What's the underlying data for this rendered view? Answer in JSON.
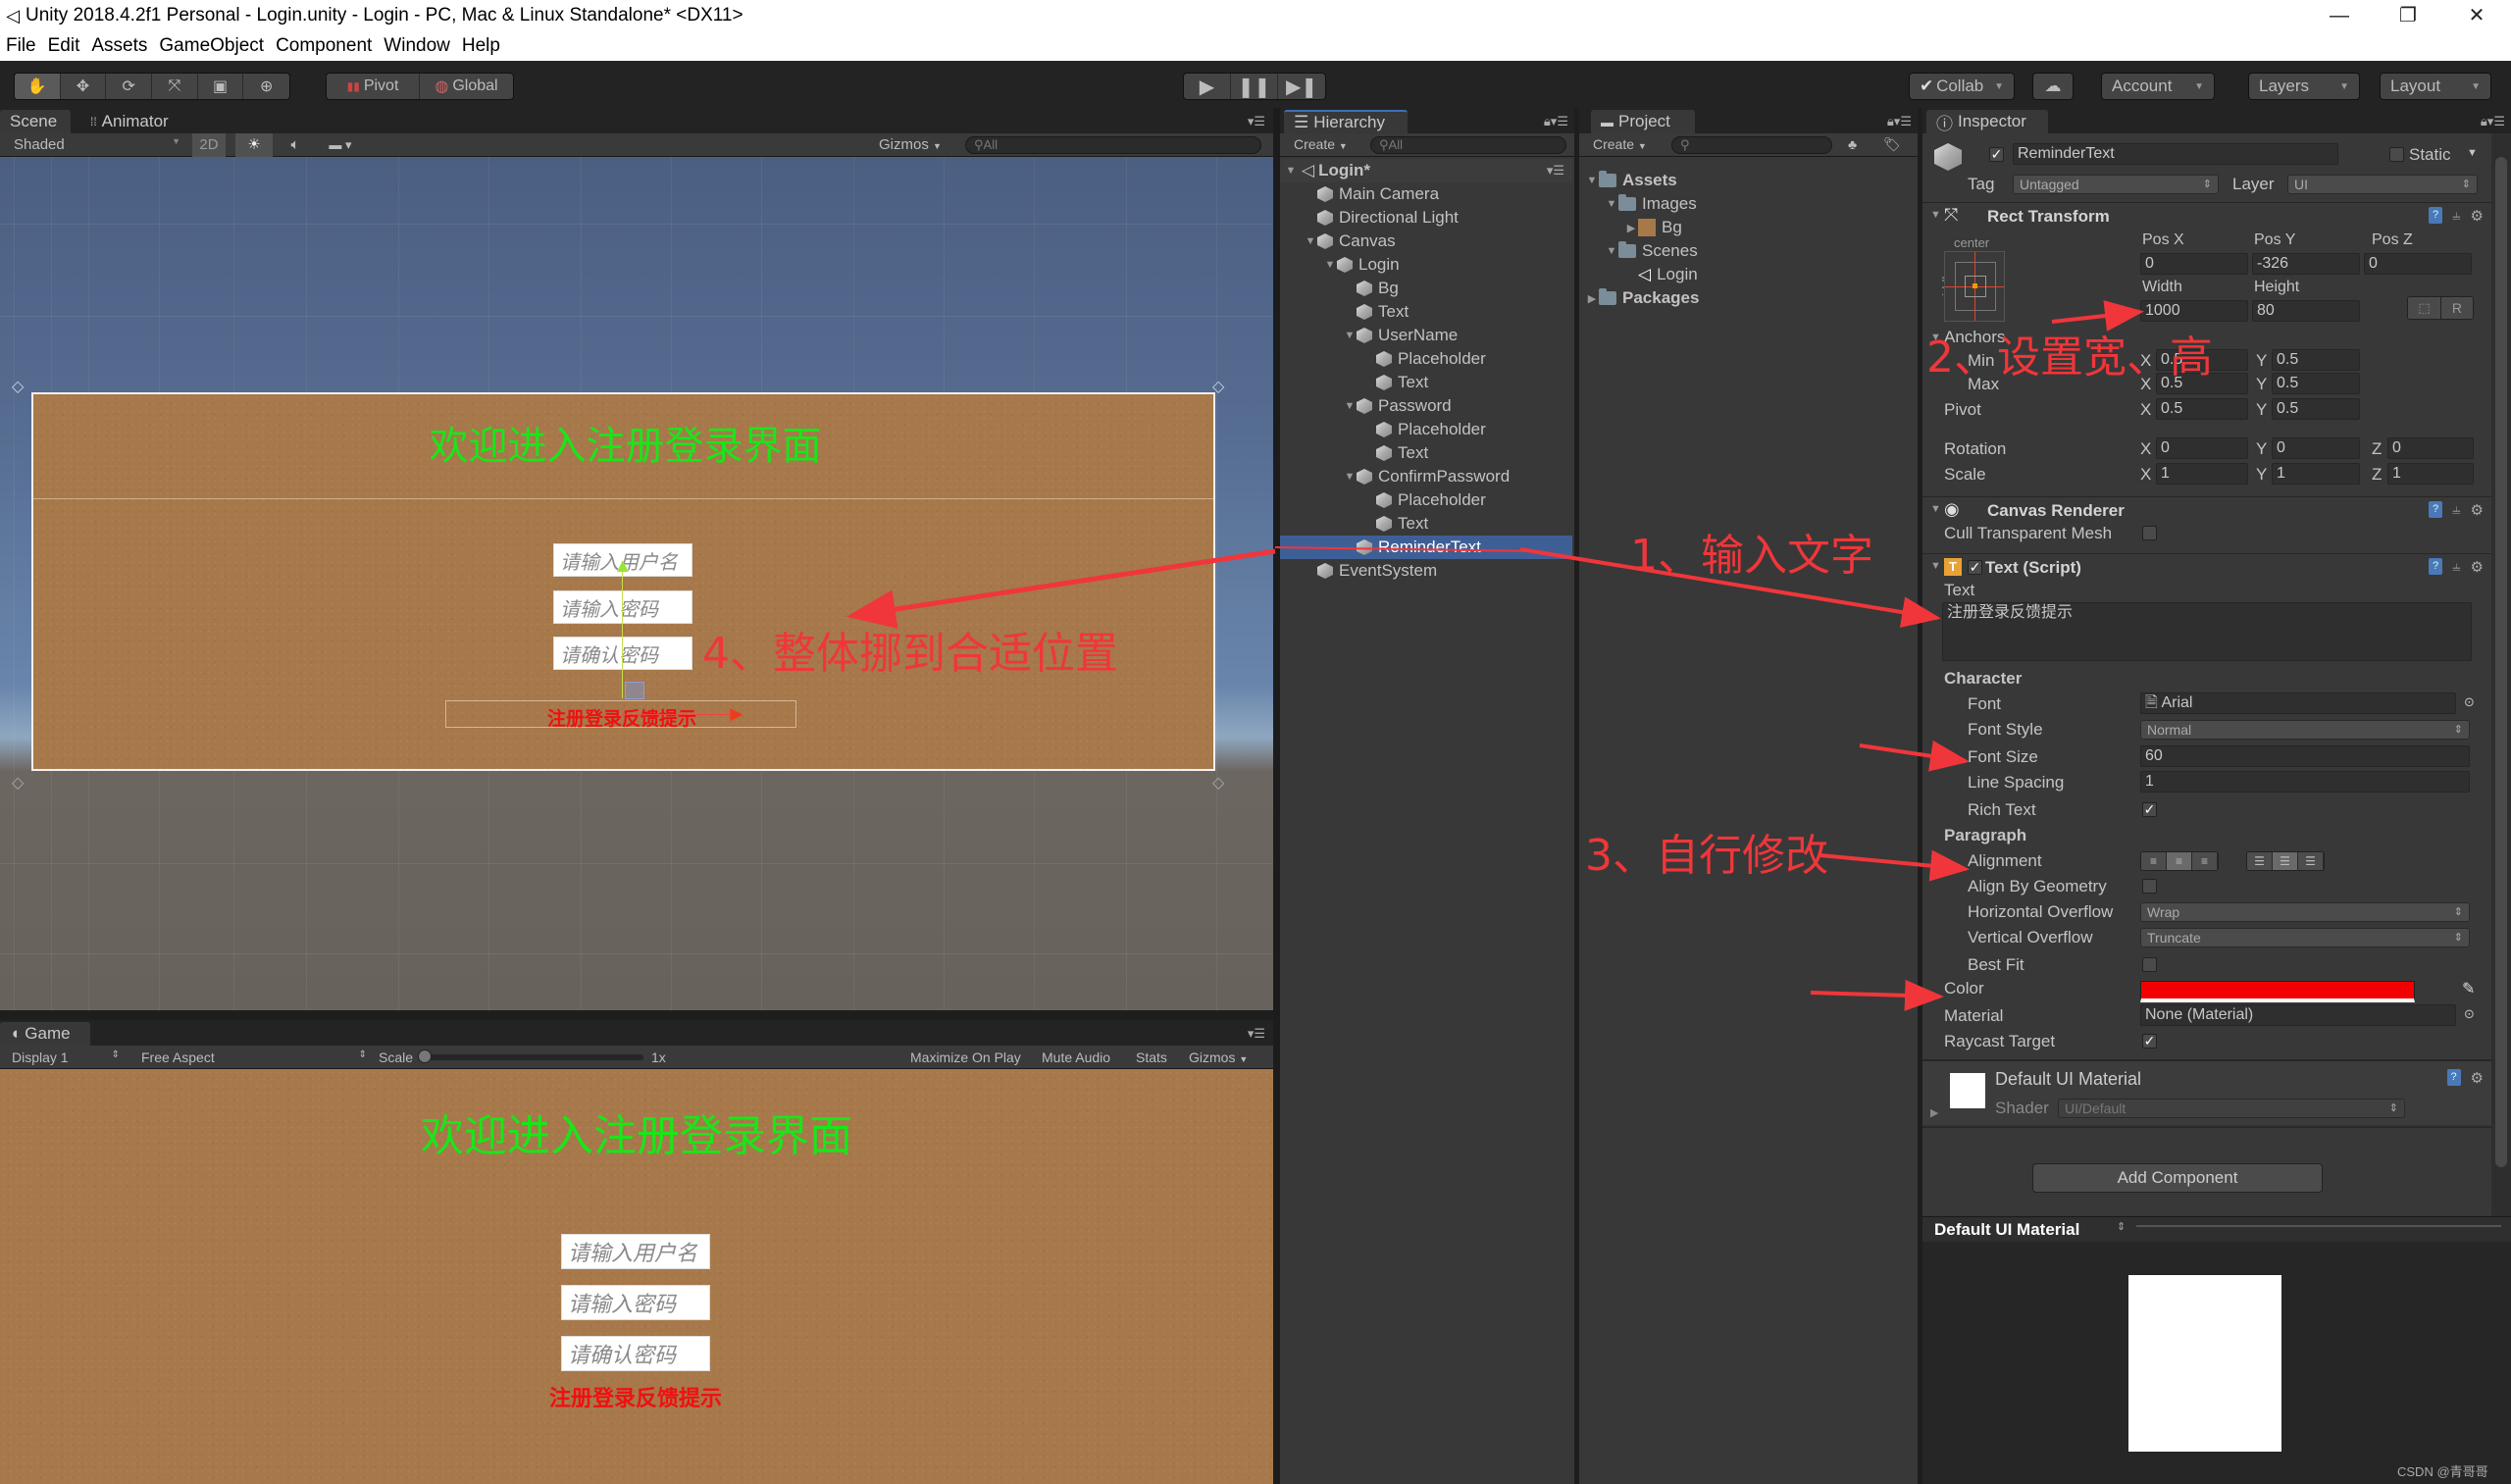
{
  "window": {
    "title": "Unity 2018.4.2f1 Personal - Login.unity - Login - PC, Mac & Linux Standalone* <DX11>",
    "controls": [
      "minimize",
      "restore",
      "close"
    ]
  },
  "menu": [
    "File",
    "Edit",
    "Assets",
    "GameObject",
    "Component",
    "Window",
    "Help"
  ],
  "toolbar": {
    "tools": [
      "hand-tool",
      "move-tool",
      "rotate-tool",
      "scale-tool",
      "rect-tool",
      "transform-tool"
    ],
    "pivot_label": "Pivot",
    "global_label": "Global",
    "play": [
      "play",
      "pause",
      "step"
    ],
    "collab_label": "Collab",
    "account_label": "Account",
    "layers_label": "Layers",
    "layout_label": "Layout"
  },
  "scene": {
    "tabs": [
      "Scene",
      "Animator"
    ],
    "shading_mode": "Shaded",
    "mode_2d": "2D",
    "gizmos_label": "Gizmos",
    "search_placeholder": "All",
    "title_text": "欢迎进入注册登录界面",
    "inputs": [
      "请输入用户名",
      "请输入密码",
      "请确认密码"
    ],
    "reminder_text": "注册登录反馈提示"
  },
  "game": {
    "tab": "Game",
    "display": "Display 1",
    "aspect": "Free Aspect",
    "scale_label": "Scale",
    "scale_value": "1x",
    "buttons": [
      "Maximize On Play",
      "Mute Audio",
      "Stats",
      "Gizmos"
    ],
    "title_text": "欢迎进入注册登录界面",
    "inputs": [
      "请输入用户名",
      "请输入密码",
      "请确认密码"
    ],
    "reminder_text": "注册登录反馈提示"
  },
  "hierarchy": {
    "tab": "Hierarchy",
    "create_label": "Create",
    "search_placeholder": "All",
    "scene_name": "Login*",
    "items": [
      {
        "label": "Main Camera",
        "depth": 1,
        "expanded": null
      },
      {
        "label": "Directional Light",
        "depth": 1,
        "expanded": null
      },
      {
        "label": "Canvas",
        "depth": 1,
        "expanded": true
      },
      {
        "label": "Login",
        "depth": 2,
        "expanded": true
      },
      {
        "label": "Bg",
        "depth": 3,
        "expanded": null
      },
      {
        "label": "Text",
        "depth": 3,
        "expanded": null
      },
      {
        "label": "UserName",
        "depth": 3,
        "expanded": true
      },
      {
        "label": "Placeholder",
        "depth": 4,
        "expanded": null
      },
      {
        "label": "Text",
        "depth": 4,
        "expanded": null
      },
      {
        "label": "Password",
        "depth": 3,
        "expanded": true
      },
      {
        "label": "Placeholder",
        "depth": 4,
        "expanded": null
      },
      {
        "label": "Text",
        "depth": 4,
        "expanded": null
      },
      {
        "label": "ConfirmPassword",
        "depth": 3,
        "expanded": true
      },
      {
        "label": "Placeholder",
        "depth": 4,
        "expanded": null
      },
      {
        "label": "Text",
        "depth": 4,
        "expanded": null
      },
      {
        "label": "ReminderText",
        "depth": 3,
        "expanded": null,
        "selected": true
      },
      {
        "label": "EventSystem",
        "depth": 1,
        "expanded": null
      }
    ]
  },
  "project": {
    "tab": "Project",
    "create_label": "Create",
    "items": [
      {
        "label": "Assets",
        "depth": 0,
        "type": "folder",
        "expanded": true,
        "bold": true
      },
      {
        "label": "Images",
        "depth": 1,
        "type": "folder",
        "expanded": true
      },
      {
        "label": "Bg",
        "depth": 2,
        "type": "texture",
        "expanded": false
      },
      {
        "label": "Scenes",
        "depth": 1,
        "type": "folder",
        "expanded": true
      },
      {
        "label": "Login",
        "depth": 2,
        "type": "scene"
      },
      {
        "label": "Packages",
        "depth": 0,
        "type": "folder",
        "expanded": false,
        "bold": true
      }
    ]
  },
  "inspector": {
    "tab": "Inspector",
    "object_name": "ReminderText",
    "active": true,
    "static_label": "Static",
    "tag_label": "Tag",
    "tag_value": "Untagged",
    "layer_label": "Layer",
    "layer_value": "UI",
    "rect_transform": {
      "title": "Rect Transform",
      "anchor_preset_h": "center",
      "anchor_preset_v": "middle",
      "pos_x_label": "Pos X",
      "pos_x": "0",
      "pos_y_label": "Pos Y",
      "pos_y": "-326",
      "pos_z_label": "Pos Z",
      "pos_z": "0",
      "width_label": "Width",
      "width": "1000",
      "height_label": "Height",
      "height": "80",
      "anchors_label": "Anchors",
      "min_label": "Min",
      "min_x": "0.5",
      "min_y": "0.5",
      "max_label": "Max",
      "max_x": "0.5",
      "max_y": "0.5",
      "pivot_label": "Pivot",
      "pivot_x": "0.5",
      "pivot_y": "0.5",
      "rotation_label": "Rotation",
      "rot_x": "0",
      "rot_y": "0",
      "rot_z": "0",
      "scale_label": "Scale",
      "scale_x": "1",
      "scale_y": "1",
      "scale_z": "1",
      "r_button": "R"
    },
    "canvas_renderer": {
      "title": "Canvas Renderer",
      "cull_label": "Cull Transparent Mesh",
      "cull_checked": false
    },
    "text_script": {
      "title": "Text (Script)",
      "text_label": "Text",
      "text_value": "注册登录反馈提示",
      "character_label": "Character",
      "font_label": "Font",
      "font_value": "Arial",
      "font_style_label": "Font Style",
      "font_style_value": "Normal",
      "font_size_label": "Font Size",
      "font_size_value": "60",
      "line_spacing_label": "Line Spacing",
      "line_spacing_value": "1",
      "rich_text_label": "Rich Text",
      "rich_text_checked": true,
      "paragraph_label": "Paragraph",
      "alignment_label": "Alignment",
      "alignment_h": "center",
      "alignment_v": "middle",
      "align_geometry_label": "Align By Geometry",
      "align_geometry_checked": false,
      "h_overflow_label": "Horizontal Overflow",
      "h_overflow_value": "Wrap",
      "v_overflow_label": "Vertical Overflow",
      "v_overflow_value": "Truncate",
      "best_fit_label": "Best Fit",
      "best_fit_checked": false,
      "color_label": "Color",
      "color_value": "#f20000",
      "material_label": "Material",
      "material_value": "None (Material)",
      "raycast_label": "Raycast Target",
      "raycast_checked": true
    },
    "material": {
      "title": "Default UI Material",
      "shader_label": "Shader",
      "shader_value": "UI/Default"
    },
    "add_component": "Add Component",
    "preview_title": "Default UI Material"
  },
  "annotations": [
    "1、输入文字",
    "2、设置宽、高",
    "3、自行修改",
    "4、整体挪到合适位置"
  ],
  "watermark": "CSDN @青哥哥",
  "colors": {
    "selection": "#3e5f96",
    "annotation": "#f0363a",
    "title_green": "#19e619",
    "reminder_red": "#f01010"
  }
}
